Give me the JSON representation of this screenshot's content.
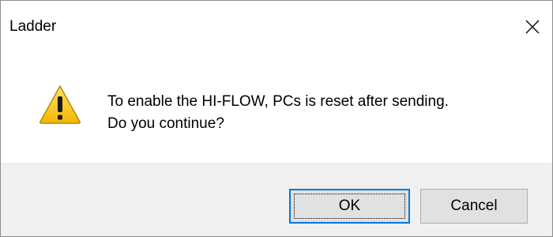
{
  "window": {
    "title": "Ladder",
    "close_glyph": "✕"
  },
  "message": {
    "line1": "To enable the HI-FLOW, PCs is reset after sending.",
    "line2": "Do you continue?",
    "icon": "warning-icon"
  },
  "buttons": {
    "ok_label": "OK",
    "cancel_label": "Cancel"
  },
  "colors": {
    "footer_bg": "#f0f0f0",
    "focus_border": "#0078d7",
    "warning_fill": "#f5c400"
  }
}
